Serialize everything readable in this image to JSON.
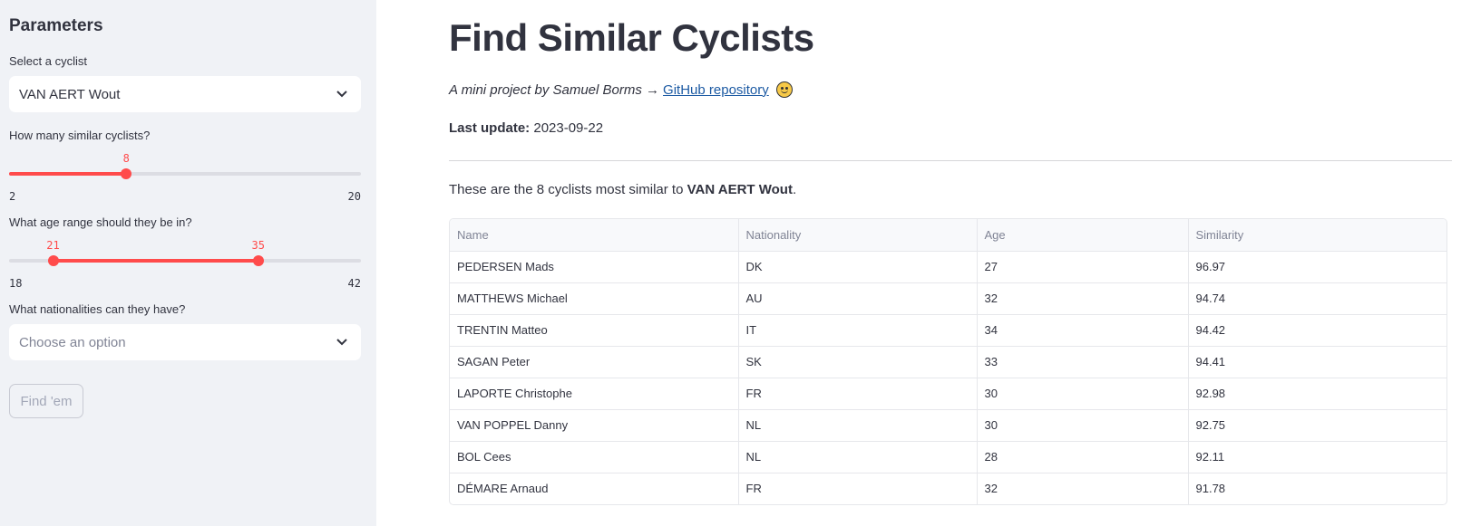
{
  "sidebar": {
    "title": "Parameters",
    "cyclist_select": {
      "label": "Select a cyclist",
      "value": "VAN AERT Wout"
    },
    "count_slider": {
      "label": "How many similar cyclists?",
      "value": "8",
      "min": "2",
      "max": "20",
      "value_fraction": 0.333
    },
    "age_slider": {
      "label": "What age range should they be in?",
      "low": "21",
      "high": "35",
      "min": "18",
      "max": "42",
      "low_fraction": 0.125,
      "high_fraction": 0.708
    },
    "nationality_select": {
      "label": "What nationalities can they have?",
      "placeholder": "Choose an option"
    },
    "find_button": "Find 'em"
  },
  "main": {
    "title": "Find Similar Cyclists",
    "byline_prefix": "A mini project by Samuel Borms →",
    "byline_link": "GitHub repository",
    "update_label": "Last update:",
    "update_value": " 2023-09-22",
    "desc_prefix": "These are the 8 cyclists most similar to ",
    "desc_name": "VAN AERT Wout",
    "desc_suffix": "."
  },
  "table": {
    "headers": [
      "Name",
      "Nationality",
      "Age",
      "Similarity"
    ],
    "rows": [
      [
        "PEDERSEN Mads",
        "DK",
        "27",
        "96.97"
      ],
      [
        "MATTHEWS Michael",
        "AU",
        "32",
        "94.74"
      ],
      [
        "TRENTIN Matteo",
        "IT",
        "34",
        "94.42"
      ],
      [
        "SAGAN Peter",
        "SK",
        "33",
        "94.41"
      ],
      [
        "LAPORTE Christophe",
        "FR",
        "30",
        "92.98"
      ],
      [
        "VAN POPPEL Danny",
        "NL",
        "30",
        "92.75"
      ],
      [
        "BOL Cees",
        "NL",
        "28",
        "92.11"
      ],
      [
        "DÉMARE Arnaud",
        "FR",
        "32",
        "91.78"
      ]
    ]
  },
  "colors": {
    "accent": "#ff4b4b",
    "sidebar_bg": "#f0f2f6",
    "link": "#1c5aa3"
  }
}
